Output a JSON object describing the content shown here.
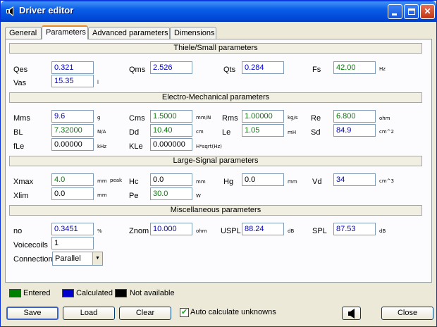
{
  "window": {
    "title": "Driver editor"
  },
  "tabs": [
    "General",
    "Parameters",
    "Advanced parameters",
    "Dimensions"
  ],
  "sections": {
    "thiele": "Thiele/Small parameters",
    "electro": "Electro-Mechanical parameters",
    "large": "Large-Signal parameters",
    "misc": "Miscellaneous parameters"
  },
  "params": {
    "qes": {
      "label": "Qes",
      "value": "0.321"
    },
    "qms": {
      "label": "Qms",
      "value": "2.526"
    },
    "qts": {
      "label": "Qts",
      "value": "0.284"
    },
    "fs": {
      "label": "Fs",
      "value": "42.00",
      "unit": "Hz"
    },
    "vas": {
      "label": "Vas",
      "value": "15.35",
      "unit": "l"
    },
    "mms": {
      "label": "Mms",
      "value": "9.6",
      "unit": "g"
    },
    "cms": {
      "label": "Cms",
      "value": "1.5000",
      "unit": "mm/N"
    },
    "rms": {
      "label": "Rms",
      "value": "1.00000",
      "unit": "kg/s"
    },
    "re": {
      "label": "Re",
      "value": "6.800",
      "unit": "ohm"
    },
    "bl": {
      "label": "BL",
      "value": "7.32000",
      "unit": "N/A"
    },
    "dd": {
      "label": "Dd",
      "value": "10.40",
      "unit": "cm"
    },
    "le": {
      "label": "Le",
      "value": "1.05",
      "unit": "mH"
    },
    "sd": {
      "label": "Sd",
      "value": "84.9",
      "unit": "cm^2"
    },
    "fle": {
      "label": "fLe",
      "value": "0.00000",
      "unit": "kHz"
    },
    "kle": {
      "label": "KLe",
      "value": "0.000000",
      "unit": "H*sqrt(Hz)"
    },
    "xmax": {
      "label": "Xmax",
      "value": "4.0",
      "unit": "mm",
      "unit2": "peak"
    },
    "hc": {
      "label": "Hc",
      "value": "0.0",
      "unit": "mm"
    },
    "hg": {
      "label": "Hg",
      "value": "0.0",
      "unit": "mm"
    },
    "vd": {
      "label": "Vd",
      "value": "34",
      "unit": "cm^3"
    },
    "xlim": {
      "label": "Xlim",
      "value": "0.0",
      "unit": "mm"
    },
    "pe": {
      "label": "Pe",
      "value": "30.0",
      "unit": "W"
    },
    "no": {
      "label": "no",
      "value": "0.3451",
      "unit": "%"
    },
    "znom": {
      "label": "Znom",
      "value": "10.000",
      "unit": "ohm"
    },
    "uspl": {
      "label": "USPL",
      "value": "88.24",
      "unit": "dB"
    },
    "spl": {
      "label": "SPL",
      "value": "87.53",
      "unit": "dB"
    },
    "voicecoils": {
      "label": "Voicecoils",
      "value": "1"
    },
    "connection": {
      "label": "Connection",
      "value": "Parallel"
    }
  },
  "legend": {
    "entered": {
      "label": "Entered",
      "color": "#008000"
    },
    "calculated": {
      "label": "Calculated",
      "color": "#0000cc"
    },
    "not_available": {
      "label": "Not available",
      "color": "#000000"
    }
  },
  "buttons": {
    "save": "Save",
    "load": "Load",
    "clear": "Clear",
    "close": "Close"
  },
  "auto_calc": {
    "label": "Auto calculate unknowns",
    "checked": true
  }
}
